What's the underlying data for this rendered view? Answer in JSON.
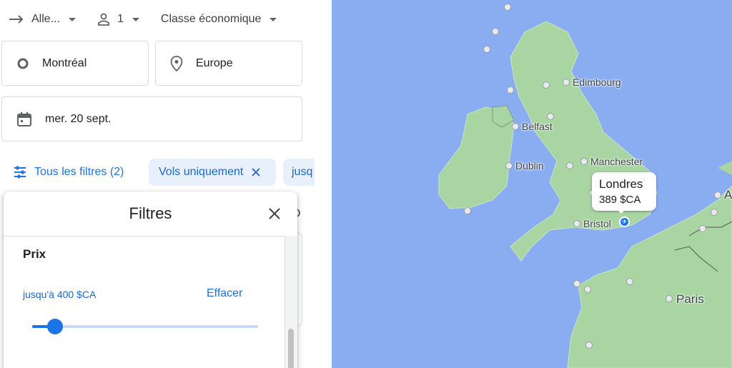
{
  "search": {
    "trip_type": "Alle...",
    "passengers": "1",
    "cabin_class": "Classe économique",
    "origin": "Montréal",
    "destination": "Europe",
    "date": "mer. 20 sept."
  },
  "filters_bar": {
    "all_filters_label": "Tous les filtres (2)",
    "chips": [
      "Vols uniquement",
      "jusq"
    ]
  },
  "filter_panel": {
    "title": "Filtres",
    "price_section_title": "Prix",
    "price_value_label": "jusqu'à 400 $CA",
    "clear_label": "Effacer",
    "price_slider_fraction": 0.1
  },
  "map": {
    "cities": [
      {
        "name": "Édimbourg",
        "size": "normal"
      },
      {
        "name": "Belfast",
        "size": "normal"
      },
      {
        "name": "Dublin",
        "size": "normal"
      },
      {
        "name": "Manchester",
        "size": "normal"
      },
      {
        "name": "Bristol",
        "size": "normal"
      },
      {
        "name": "Paris",
        "size": "big"
      },
      {
        "name": "A",
        "size": "big"
      }
    ],
    "selected": {
      "city": "Londres",
      "price": "389 $CA"
    },
    "colors": {
      "water": "#8aadf2",
      "land": "#a8d5a2",
      "accent": "#1a73e8"
    }
  }
}
